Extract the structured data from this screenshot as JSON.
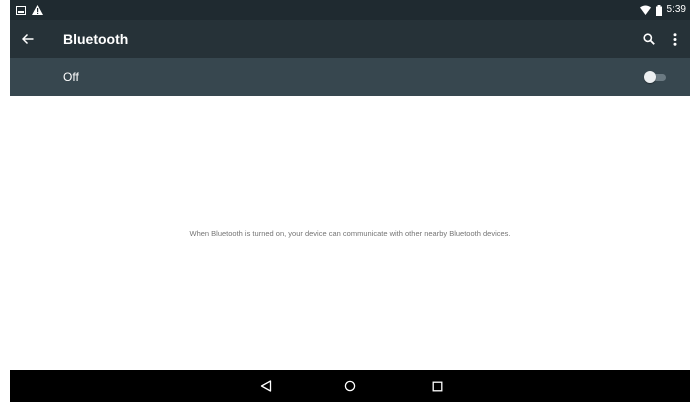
{
  "status_bar": {
    "left_icons": [
      "screenshot-notification-icon",
      "warning-icon"
    ],
    "right_icons": [
      "wifi-icon",
      "battery-icon"
    ],
    "time": "5:39"
  },
  "toolbar": {
    "back_icon": "arrow-left-icon",
    "title": "Bluetooth",
    "search_icon": "search-icon",
    "overflow_icon": "more-vert-icon"
  },
  "switch_bar": {
    "label": "Off",
    "toggle_state": "off"
  },
  "content": {
    "empty_message": "When Bluetooth is turned on, your device can communicate with other nearby Bluetooth devices."
  },
  "nav_bar": {
    "icons": [
      "nav-back-icon",
      "nav-home-icon",
      "nav-recents-icon"
    ]
  },
  "colors": {
    "status_bar": "#1f2a30",
    "toolbar": "#263238",
    "switch_bar": "#37474f",
    "nav_bar": "#000000",
    "body": "#ffffff",
    "message_text": "#757575"
  }
}
